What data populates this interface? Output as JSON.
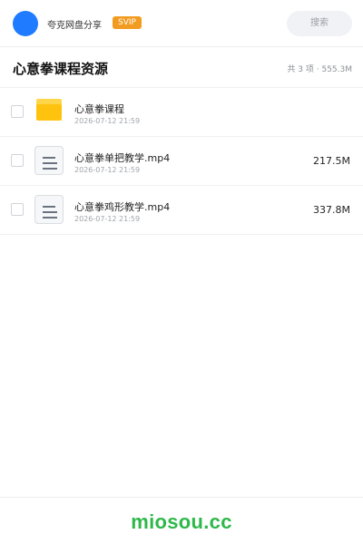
{
  "header": {
    "user_name": "夸克网盘分享",
    "badge": "SVIP",
    "search_placeholder": "搜索"
  },
  "title_bar": {
    "title": "心意拳课程资源",
    "summary": "共 3 项 · 555.3M"
  },
  "files": [
    {
      "name": "心意拳课程",
      "date": "2026-07-12 21:59",
      "size": "",
      "type": "folder"
    },
    {
      "name": "心意拳单把教学.mp4",
      "date": "2026-07-12 21:59",
      "size": "217.5M",
      "type": "video"
    },
    {
      "name": "心意拳鸡形教学.mp4",
      "date": "2026-07-12 21:59",
      "size": "337.8M",
      "type": "video"
    }
  ],
  "footer": {
    "brand": "miosou.cc"
  },
  "colors": {
    "accent": "#1f7bff",
    "svip": "#f29b21",
    "folder": "#ffc20e",
    "brand": "#2fb84a"
  }
}
